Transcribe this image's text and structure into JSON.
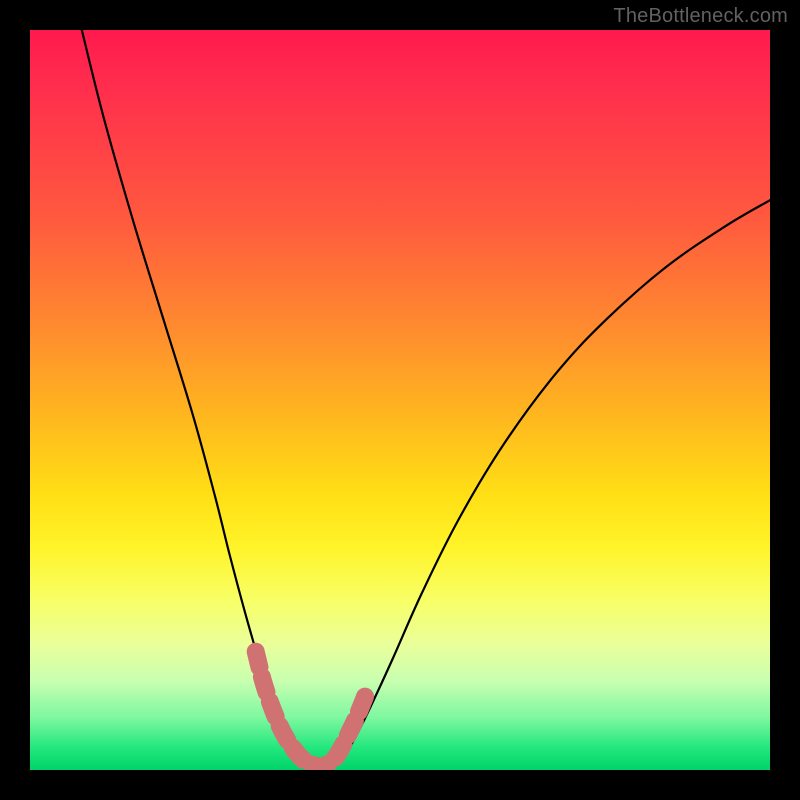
{
  "watermark": "TheBottleneck.com",
  "colors": {
    "background": "#000000",
    "gradient_top": "#ff1a4d",
    "gradient_mid_upper": "#ff8a2f",
    "gradient_mid": "#ffe015",
    "gradient_mid_lower": "#f8ff66",
    "gradient_bottom": "#00d46a",
    "curve_stroke": "#000000",
    "trough_marker": "#d17272"
  },
  "chart_data": {
    "type": "line",
    "title": "",
    "xlabel": "",
    "ylabel": "",
    "xlim": [
      0,
      100
    ],
    "ylim": [
      0,
      100
    ],
    "series": [
      {
        "name": "bottleneck-curve",
        "x": [
          7,
          10,
          14,
          18,
          22,
          25,
          27,
          29,
          31,
          32.5,
          34,
          35.5,
          37,
          38,
          39,
          40,
          41,
          42.5,
          44,
          46,
          49,
          53,
          58,
          64,
          71,
          78,
          86,
          94,
          100
        ],
        "values": [
          100,
          88,
          74,
          61,
          48,
          37,
          29,
          21.5,
          14.5,
          9.5,
          5.5,
          2.8,
          1.2,
          0.5,
          0.3,
          0.3,
          0.7,
          2.0,
          4.5,
          8.5,
          15,
          24,
          34,
          44,
          53.5,
          61,
          68,
          73.5,
          77
        ]
      }
    ],
    "trough_markers": {
      "name": "optimal-region",
      "x": [
        30.5,
        31.5,
        32.5,
        33.5,
        34.5,
        35.5,
        36.5,
        37.5,
        38.5,
        39.5,
        40.5,
        41.5,
        42.5,
        43.5,
        44.5,
        45.5
      ],
      "values": [
        16,
        12,
        9,
        6.5,
        4.5,
        3,
        1.8,
        1.0,
        0.6,
        0.5,
        1.0,
        2.0,
        3.8,
        5.8,
        8.0,
        10.5
      ]
    }
  }
}
